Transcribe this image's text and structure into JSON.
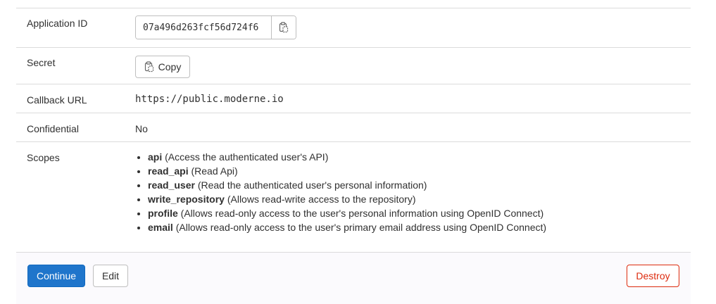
{
  "rows": {
    "application_id": {
      "label": "Application ID",
      "value": "07a496d263fcf56d724f6"
    },
    "secret": {
      "label": "Secret",
      "copy_label": "Copy"
    },
    "callback": {
      "label": "Callback URL",
      "value": "https://public.moderne.io"
    },
    "confidential": {
      "label": "Confidential",
      "value": "No"
    },
    "scopes": {
      "label": "Scopes",
      "items": [
        {
          "name": "api",
          "desc": "(Access the authenticated user's API)"
        },
        {
          "name": "read_api",
          "desc": "(Read Api)"
        },
        {
          "name": "read_user",
          "desc": "(Read the authenticated user's personal information)"
        },
        {
          "name": "write_repository",
          "desc": "(Allows read-write access to the repository)"
        },
        {
          "name": "profile",
          "desc": "(Allows read-only access to the user's personal information using OpenID Connect)"
        },
        {
          "name": "email",
          "desc": "(Allows read-only access to the user's primary email address using OpenID Connect)"
        }
      ]
    }
  },
  "footer": {
    "continue_label": "Continue",
    "edit_label": "Edit",
    "destroy_label": "Destroy"
  },
  "icons": {
    "copy": "clipboard-icon"
  },
  "colors": {
    "primary": "#1f75cb",
    "danger": "#dd2b0e",
    "border": "#dbdbdb"
  }
}
